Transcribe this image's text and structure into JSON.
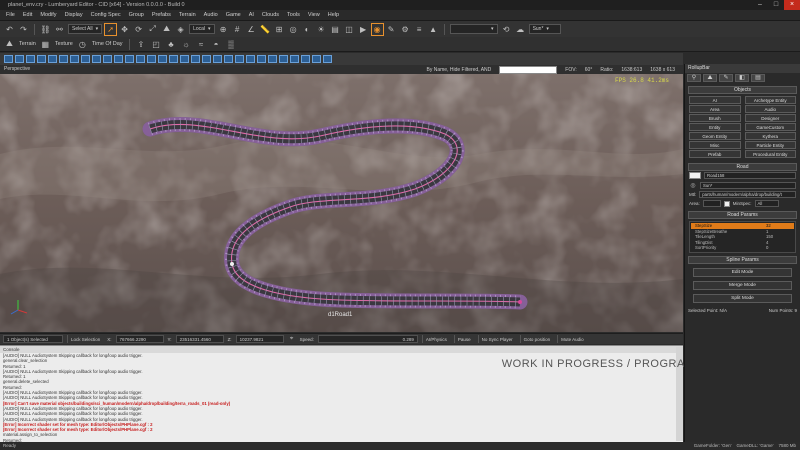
{
  "window": {
    "title": "planet_env.cry - Lumberyard Editor - CID [x64] - Version 0.0.0.0 - Build 0"
  },
  "menu": [
    "File",
    "Edit",
    "Modify",
    "Display",
    "Config Spec",
    "Group",
    "Prefabs",
    "Terrain",
    "Audio",
    "Game",
    "AI",
    "Clouds",
    "Tools",
    "View",
    "Help"
  ],
  "toolbar": {
    "select_mode": "Select All",
    "coord": "Local",
    "profile": "Sun*"
  },
  "toolbar2": {
    "terrain": "Terrain",
    "texture": "Texture",
    "time_of_day": "Time Of Day"
  },
  "viewport": {
    "label": "Perspective",
    "search_mode": "By Name, Hide Filtered, AND",
    "fov_label": "FOV:",
    "fov_value": "60°",
    "ratio_label": "Ratio:",
    "ratio_value": "1638:613",
    "resolution": "1638 x 613",
    "fps": "FPS 26.8   41.2ms",
    "object_label": "d1Road1"
  },
  "status": {
    "selection": "1 Object(s) Selected",
    "lock": "Lock Selection",
    "x": "767666.2290",
    "y": "23516331.4560",
    "z": "10237.9821",
    "speed_label": "Speed:",
    "speed_value": "0.289",
    "physics": "AI/Physics",
    "pause": "Pause",
    "nosync": "No Sync Player",
    "goto": "Goto position",
    "mute": "Mute Audio"
  },
  "console": {
    "title": "Console",
    "lines": [
      {
        "t": "[AUDIO] NULL AudioSystem Skipping callback for long/loop audio trigger.",
        "err": false
      },
      {
        "t": "general.clear_selection",
        "err": false
      },
      {
        "t": "Returned: 1",
        "err": false
      },
      {
        "t": "[AUDIO] NULL AudioSystem Skipping callback for long/loop audio trigger.",
        "err": false
      },
      {
        "t": "Returned: 1",
        "err": false
      },
      {
        "t": "general.delete_selected",
        "err": false
      },
      {
        "t": "Returned:",
        "err": false
      },
      {
        "t": "[AUDIO] NULL AudioSystem Skipping callback for long/loop audio trigger.",
        "err": false
      },
      {
        "t": "[AUDIO] NULL AudioSystem Skipping callback for long/loop audio trigger.",
        "err": false
      },
      {
        "t": "[Error] Can't save material objects/buildings/sci_human/modern/alpha/drop/building/terra_roads_01 (read-only)",
        "err": true
      },
      {
        "t": "[AUDIO] NULL AudioSystem Skipping callback for long/loop audio trigger.",
        "err": false
      },
      {
        "t": "[AUDIO] NULL AudioSystem Skipping callback for long/loop audio trigger.",
        "err": false
      },
      {
        "t": "[AUDIO] NULL AudioSystem Skipping callback for long/loop audio trigger.",
        "err": false
      },
      {
        "t": "[Error] Incorrect shader set for mesh type: Editor/Objects/PHPlane.cgf : 2",
        "err": true
      },
      {
        "t": "[Error] Incorrect shader set for mesh type: Editor/Objects/PHPlane.cgf : 2",
        "err": true
      },
      {
        "t": "material.assign_to_selection",
        "err": false
      },
      {
        "t": "Returned:",
        "err": false
      }
    ],
    "watermark": "WORK IN PROGRESS / PROGRAMMER MATERIALS"
  },
  "bottom": {
    "ready": "Ready",
    "gamefolder": "GameFolder: 'Gen'",
    "gamedll": "GameDLL: 'Game'",
    "mem": "7580 Mb"
  },
  "panel": {
    "title": "RollupBar",
    "objects_header": "Objects",
    "objects": [
      "AI",
      "Archetype Entity",
      "Area",
      "Audio",
      "Brush",
      "Designer",
      "Entity",
      "GameCustom",
      "Geom Entity",
      "Kythera",
      "Misc",
      "Particle Entity",
      "Prefab",
      "Procedural Entity"
    ],
    "road_header": "Road",
    "road_name": "Road158",
    "road_layer": "Sun*",
    "mtl_label": "Mtl:",
    "mtl_value": "parts/human/modern/alpha/drop/building/t",
    "area_label": "Area:",
    "minspec_label": "MinSpec:",
    "minspec_value": "All",
    "road_params_header": "Road Params",
    "params": [
      {
        "k": "StepSize",
        "v": "32",
        "sel": true
      },
      {
        "k": "StepSizeBreathe",
        "v": "1"
      },
      {
        "k": "TileLength",
        "v": "150"
      },
      {
        "k": "TilingDist",
        "v": "4"
      },
      {
        "k": "SortPriority",
        "v": "0"
      }
    ],
    "spline_header": "Spline Params",
    "edit_mode": "Edit Mode",
    "merge_mode": "Merge Mode",
    "split_mode": "Split Mode",
    "selected_point": "Selected Point: N/A",
    "num_points": "Num Points: 9"
  }
}
